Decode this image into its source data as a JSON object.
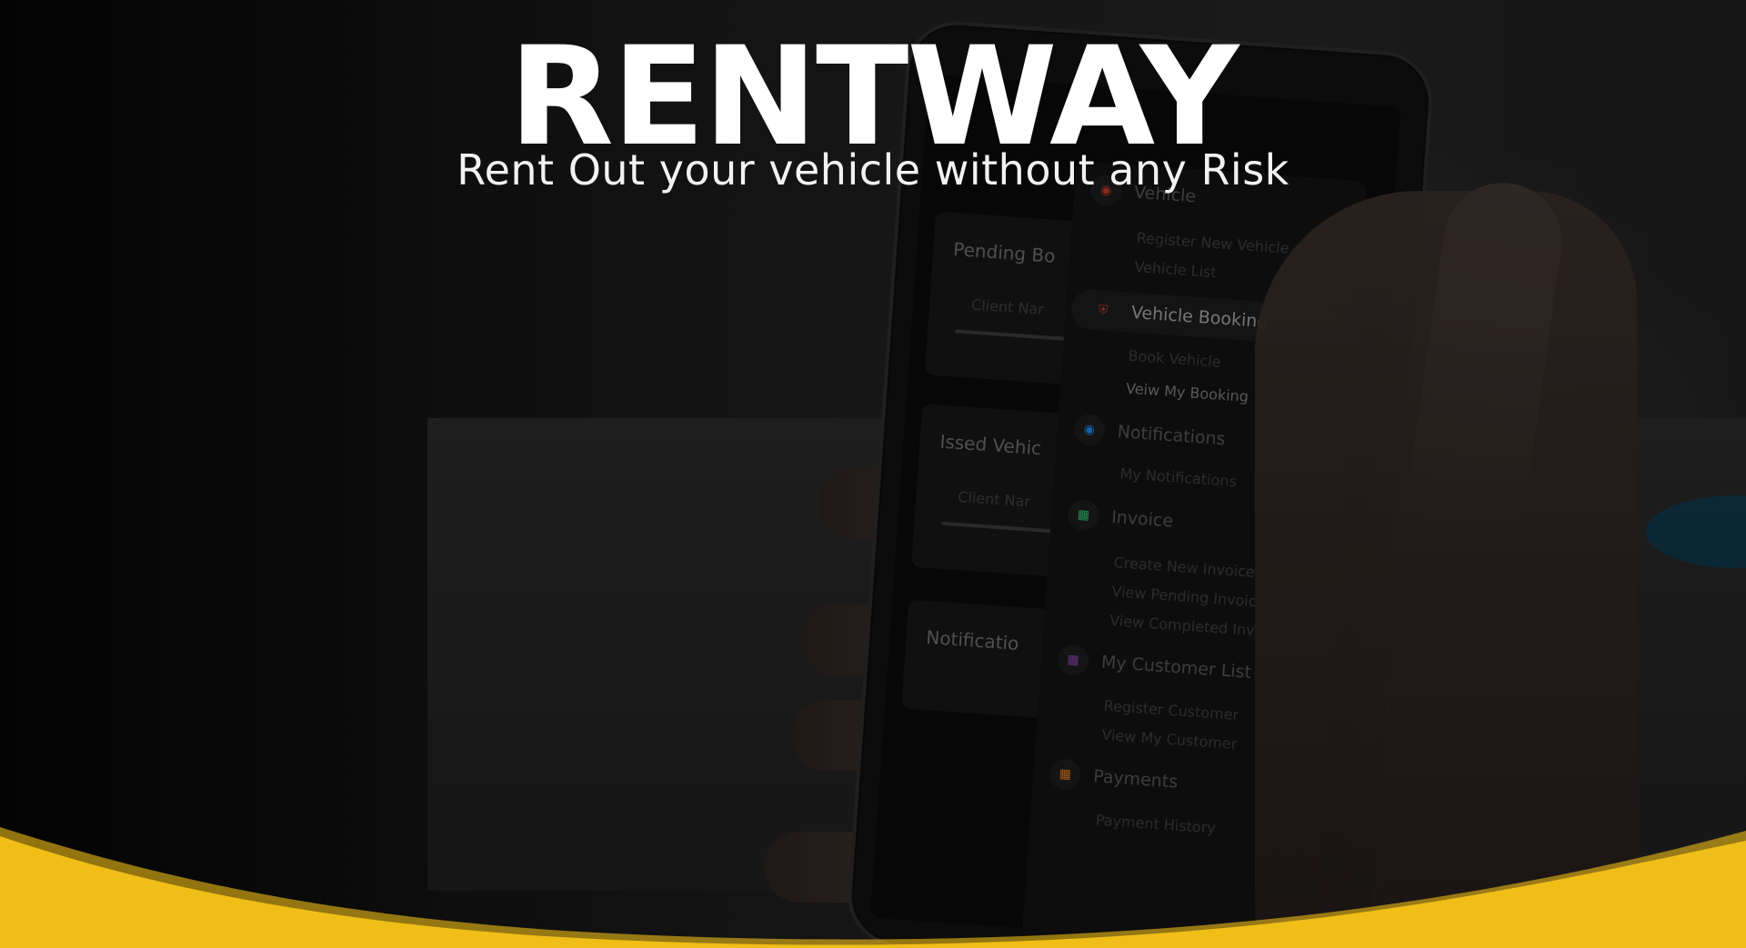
{
  "hero": {
    "brand": "RENTWAY",
    "tagline": "Rent Out your vehicle without any Risk"
  },
  "colors": {
    "brand_yellow": "#F0BE18",
    "headline": "#FFFFFF",
    "background": "#161616"
  },
  "phone_screen": {
    "cards": [
      {
        "title": "Pending Bo",
        "sub": "Client Nar"
      },
      {
        "title": "Issed Vehic",
        "sub": "Client Nar"
      },
      {
        "title": "Notificatio",
        "sub": ""
      }
    ],
    "menu": [
      {
        "label": "Vehicle",
        "icon": "car-icon",
        "icon_color": "#c0392b"
      },
      {
        "label": "Vehicle Booking",
        "icon": "shield-icon",
        "icon_color": "#c0392b"
      },
      {
        "label": "Notifications",
        "icon": "globe-icon",
        "icon_color": "#1e88e5"
      },
      {
        "label": "Invoice",
        "icon": "grid-icon",
        "icon_color": "#2ecc71"
      },
      {
        "label": "My Customer List",
        "icon": "grid-icon",
        "icon_color": "#8e44ad"
      },
      {
        "label": "Payments",
        "icon": "grid-icon",
        "icon_color": "#e67e22"
      }
    ],
    "submenu": {
      "vehicle": [
        "Register New Vehicle",
        "Vehicle List"
      ],
      "booking": [
        "Book Vehicle",
        "Veiw My Booking"
      ],
      "notifications": [
        "My Notifications"
      ],
      "invoice": [
        "Create New Invoice",
        "View Pending Invoice",
        "View Completed Invoice"
      ],
      "customers": [
        "Register Customer",
        "View My Customer"
      ],
      "payments": [
        "Payment History"
      ]
    }
  }
}
